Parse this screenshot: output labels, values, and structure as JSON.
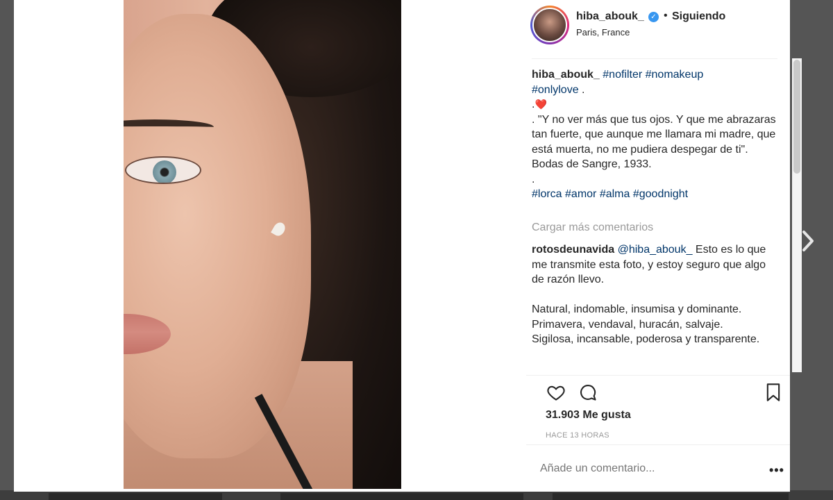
{
  "post": {
    "username": "hiba_abouk_",
    "follow_status": "Siguiendo",
    "location": "Paris, France",
    "caption_hashtags_1": "#nofilter #nomakeup",
    "caption_hashtags_2": "#onlylove",
    "caption_dot_after": " .",
    "caption_line_dot_heart": ".",
    "heart_emoji": "❤️",
    "caption_quote": ". \"Y no ver más que tus ojos. Y que me abrazaras tan fuerte, que aunque me llamara mi madre, que está muerta, no me pudiera despegar de ti\". Bodas de Sangre, 1933.",
    "caption_line_dot2": ".",
    "caption_hashtags_3": "#lorca #amor #alma #goodnight",
    "load_more_comments": "Cargar más comentarios",
    "likes": "31.903 Me gusta",
    "time_ago": "HACE 13 HORAS",
    "add_comment_placeholder": "Añade un comentario..."
  },
  "comments": [
    {
      "username": "rotosdeunavida",
      "mention": "@hiba_abouk_",
      "text_1": " Esto es lo que me transmite esta foto, y estoy seguro que algo de razón llevo.",
      "text_2": "Natural, indomable, insumisa y dominante.",
      "text_3": "Primavera, vendaval, huracán, salvaje.",
      "text_4": "Sigilosa, incansable, poderosa y transparente."
    }
  ],
  "icons": {
    "like": "heart-icon",
    "comment": "comment-icon",
    "save": "bookmark-icon",
    "more": "more-options-icon",
    "next": "chevron-right-icon",
    "verified": "verified-badge-icon"
  },
  "colors": {
    "accent": "#3897f0",
    "hashtag": "#003569",
    "muted": "#999999"
  }
}
